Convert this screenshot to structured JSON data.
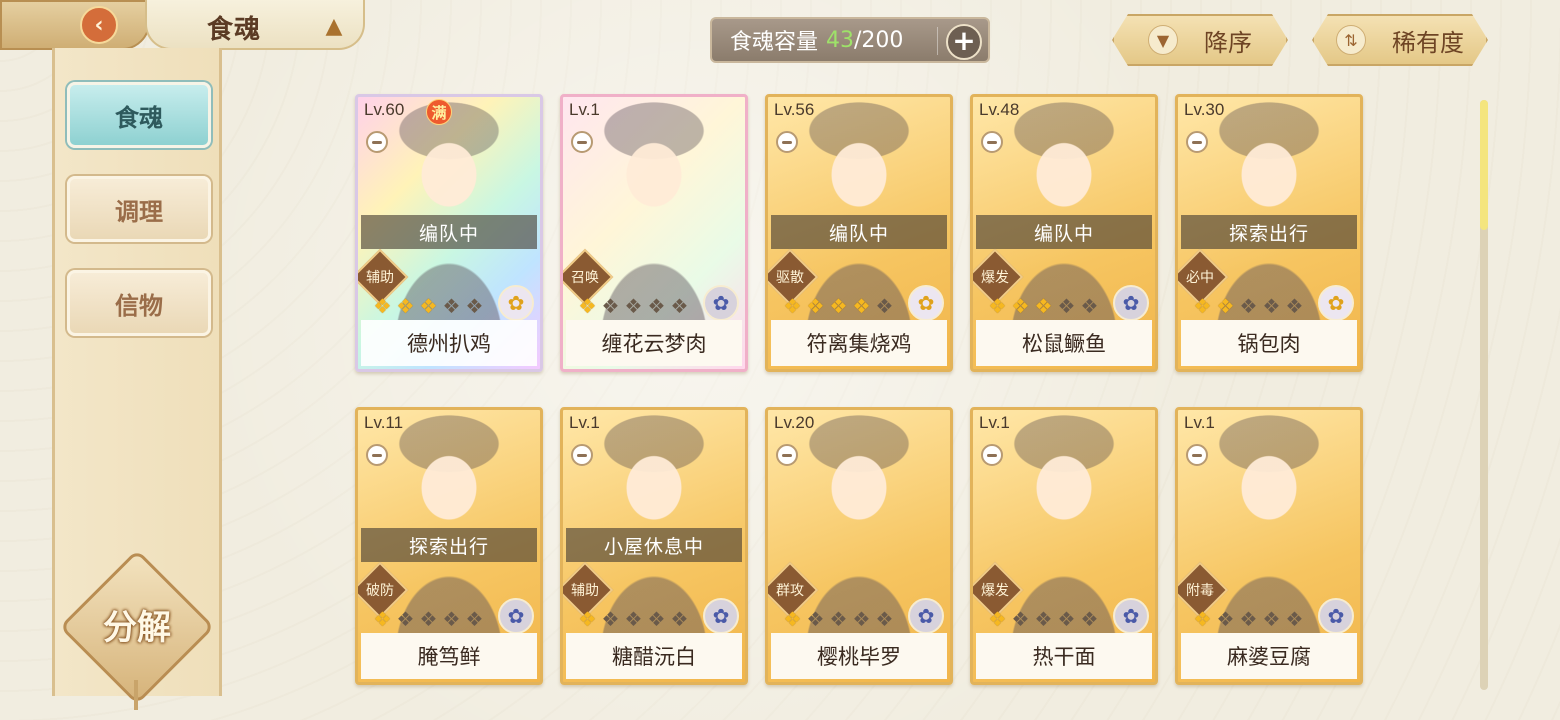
{
  "header": {
    "title": "食魂",
    "capacity_label": "食魂容量",
    "capacity_current": "43",
    "capacity_max": "/200",
    "plus": "+",
    "sort_order": "降序",
    "sort_field": "稀有度"
  },
  "sidebar": {
    "tabs": [
      {
        "label": "食魂",
        "active": true
      },
      {
        "label": "调理",
        "active": false
      },
      {
        "label": "信物",
        "active": false
      }
    ],
    "decompose": "分解"
  },
  "cards": [
    {
      "level": "Lv.60",
      "max_badge": "满",
      "status": "编队中",
      "role": "辅助",
      "stars": 3,
      "name": "德州扒鸡",
      "element": "gold",
      "frame": "rainbow"
    },
    {
      "level": "Lv.1",
      "max_badge": "",
      "status": "",
      "role": "召唤",
      "stars": 1,
      "name": "缠花云梦肉",
      "element": "blue",
      "frame": "pastel"
    },
    {
      "level": "Lv.56",
      "max_badge": "",
      "status": "编队中",
      "role": "驱散",
      "stars": 4,
      "name": "符离集烧鸡",
      "element": "gold",
      "frame": "gold"
    },
    {
      "level": "Lv.48",
      "max_badge": "",
      "status": "编队中",
      "role": "爆发",
      "stars": 3,
      "name": "松鼠鳜鱼",
      "element": "blue",
      "frame": "gold"
    },
    {
      "level": "Lv.30",
      "max_badge": "",
      "status": "探索出行",
      "role": "必中",
      "stars": 2,
      "name": "锅包肉",
      "element": "gold",
      "frame": "gold"
    },
    {
      "level": "Lv.11",
      "max_badge": "",
      "status": "探索出行",
      "role": "破防",
      "stars": 1,
      "name": "腌笃鲜",
      "element": "blue",
      "frame": "gold"
    },
    {
      "level": "Lv.1",
      "max_badge": "",
      "status": "小屋休息中",
      "role": "辅助",
      "stars": 1,
      "name": "糖醋沅白",
      "element": "blue",
      "frame": "gold"
    },
    {
      "level": "Lv.20",
      "max_badge": "",
      "status": "",
      "role": "群攻",
      "stars": 1,
      "name": "樱桃毕罗",
      "element": "blue",
      "frame": "gold"
    },
    {
      "level": "Lv.1",
      "max_badge": "",
      "status": "",
      "role": "爆发",
      "stars": 1,
      "name": "热干面",
      "element": "blue",
      "frame": "gold"
    },
    {
      "level": "Lv.1",
      "max_badge": "",
      "status": "",
      "role": "附毒",
      "stars": 1,
      "name": "麻婆豆腐",
      "element": "blue",
      "frame": "gold"
    }
  ],
  "icons": {
    "back": "back-arrow-icon",
    "home": "pavilion-icon",
    "sort_desc": "triangle-down-icon",
    "sort_rarity": "sort-arrows-icon",
    "star": "flame-star-icon",
    "element_gold": "gold-flower-icon",
    "element_blue": "blue-flower-icon"
  },
  "scroll": {
    "position": 0
  }
}
